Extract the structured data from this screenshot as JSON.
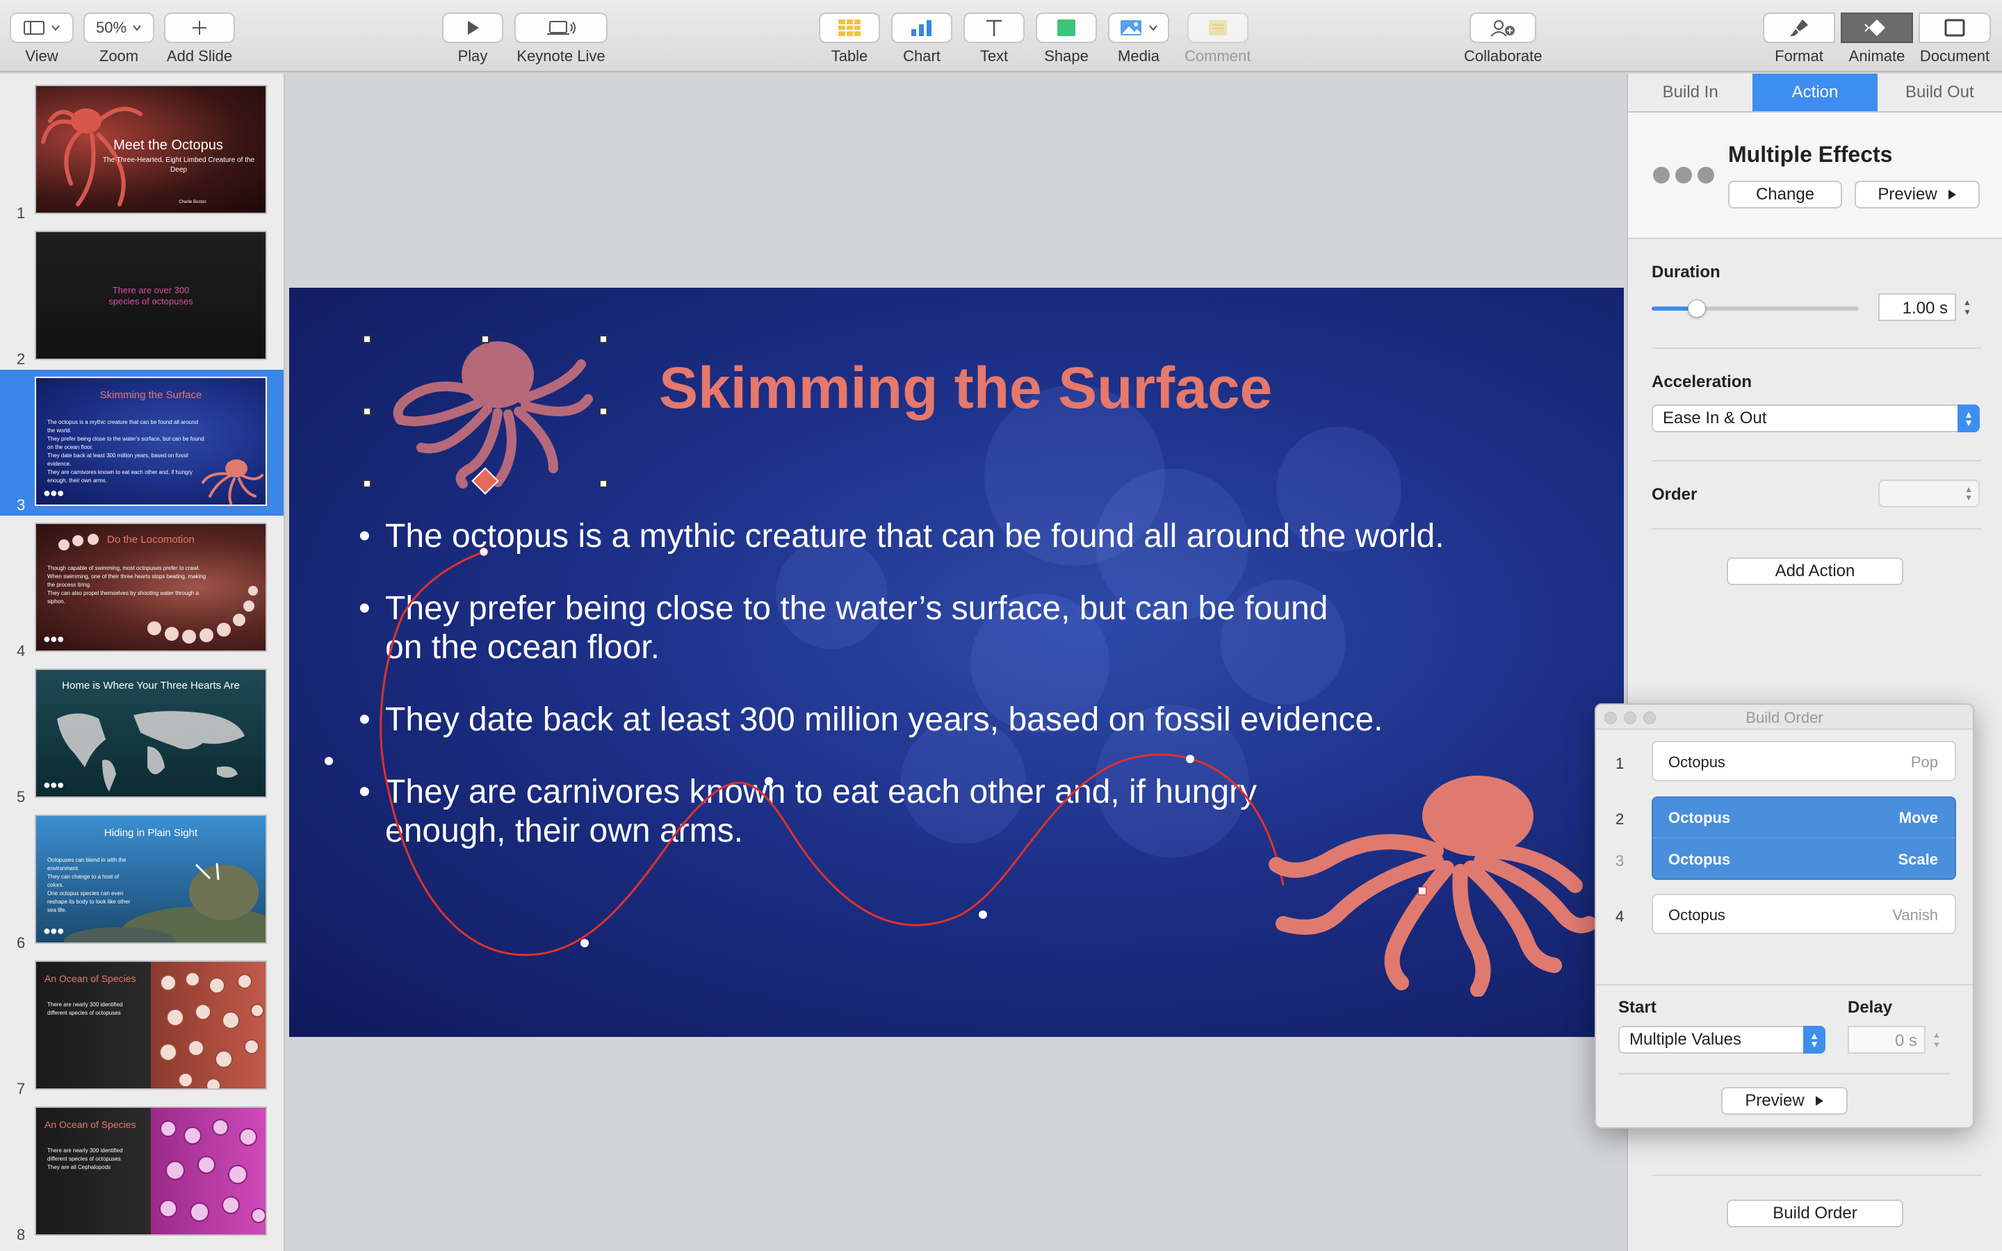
{
  "toolbar": {
    "view_label": "View",
    "zoom_value": "50%",
    "zoom_label": "Zoom",
    "add_slide_label": "Add Slide",
    "play_label": "Play",
    "keynote_live_label": "Keynote Live",
    "table_label": "Table",
    "chart_label": "Chart",
    "text_label": "Text",
    "shape_label": "Shape",
    "media_label": "Media",
    "comment_label": "Comment",
    "collaborate_label": "Collaborate",
    "format_label": "Format",
    "animate_label": "Animate",
    "document_label": "Document"
  },
  "sidebar": {
    "slides": [
      {
        "num": "1",
        "title": "Meet the Octopus",
        "subtitle": "The Three-Hearted, Eight Limbed Creature of the Deep",
        "author": "Charlie Buston"
      },
      {
        "num": "2",
        "title": "There are over 300 species of octopuses"
      },
      {
        "num": "3",
        "title": "Skimming the Surface",
        "selected": true,
        "bullets": [
          "The octopus is a mythic creature that can be found all around the world.",
          "They prefer being close to the water's surface, but can be found on the ocean floor.",
          "They date back at least 300 million years, based on fossil evidence.",
          "They are carnivores known to eat each other and, if hungry enough, their own arms."
        ]
      },
      {
        "num": "4",
        "title": "Do the Locomotion",
        "bullets": [
          "Though capable of swimming, most octopuses prefer to crawl.",
          "When swimming, one of their three hearts stops beating, making the process tiring.",
          "They can also propel themselves by shooting water through a siphon."
        ]
      },
      {
        "num": "5",
        "title": "Home is Where Your Three Hearts Are"
      },
      {
        "num": "6",
        "title": "Hiding in Plain Sight",
        "bullets": [
          "Octopuses can blend in with the environment.",
          "They can change to a host of colors.",
          "One octopus species can even reshape its body to look like other sea life."
        ]
      },
      {
        "num": "7",
        "title": "An Ocean of Species",
        "bullets": [
          "There are nearly 300 identified different species of octopuses"
        ]
      },
      {
        "num": "8",
        "title": "An Ocean of Species",
        "bullets": [
          "There are nearly 300 identified different species of octopuses",
          "They are all Cephalopods"
        ]
      }
    ]
  },
  "slide": {
    "title": "Skimming the Surface",
    "bullets": [
      "The octopus is a mythic creature that can be found all around the world.",
      "They prefer being close to the water’s surface, but can be found on the ocean floor.",
      "They date back at least 300 million years, based on fossil evidence.",
      "They are carnivores known to eat each other and, if hungry enough, their own arms."
    ],
    "accent_color": "#e6786c"
  },
  "inspector": {
    "tabs": [
      "Build In",
      "Action",
      "Build Out"
    ],
    "active_tab": "Action",
    "effect_name": "Multiple Effects",
    "change_label": "Change",
    "preview_label": "Preview",
    "duration_label": "Duration",
    "duration_value": "1.00 s",
    "duration_slider_fraction": 0.2,
    "acceleration_label": "Acceleration",
    "acceleration_value": "Ease In & Out",
    "order_label": "Order",
    "add_action_label": "Add Action",
    "build_order_button": "Build Order"
  },
  "build_order": {
    "title": "Build Order",
    "items": [
      {
        "index": "1",
        "name": "Octopus",
        "effect": "Pop",
        "selected": false
      },
      {
        "index": "2",
        "name": "Octopus",
        "effect": "Move",
        "selected": true
      },
      {
        "index": "3",
        "name": "Octopus",
        "effect": "Scale",
        "selected": true
      },
      {
        "index": "4",
        "name": "Octopus",
        "effect": "Vanish",
        "selected": false
      }
    ],
    "start_label": "Start",
    "start_value": "Multiple Values",
    "delay_label": "Delay",
    "delay_value": "0 s",
    "preview_label": "Preview"
  }
}
